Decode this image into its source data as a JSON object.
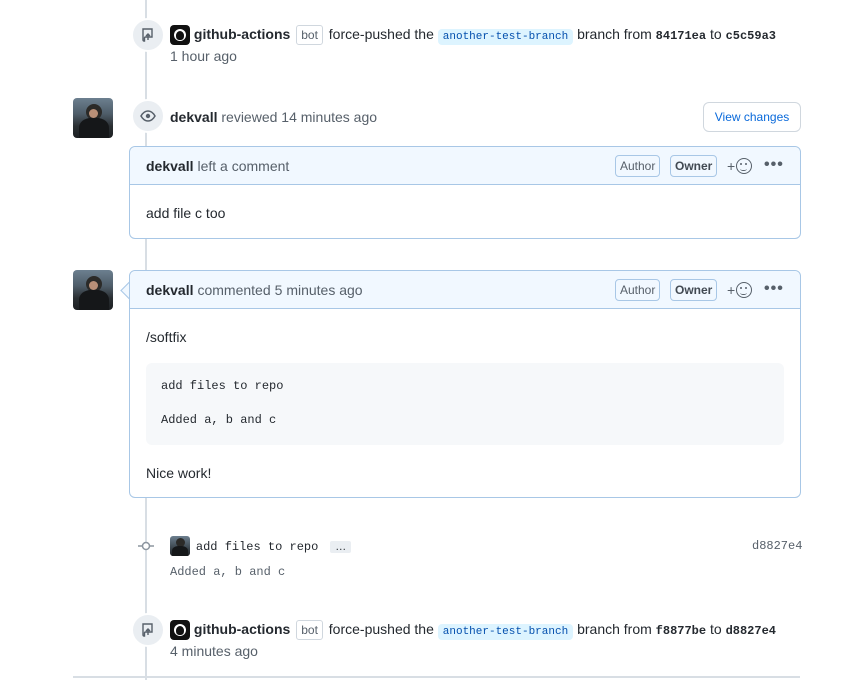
{
  "event1": {
    "actor": "github-actions",
    "bot_label": "bot",
    "action": "force-pushed the",
    "branch": "another-test-branch",
    "branch_word": "branch from",
    "from_sha": "84171ea",
    "to_word": "to",
    "to_sha": "c5c59a3",
    "time": "1 hour ago"
  },
  "review": {
    "actor": "dekvall",
    "action": "reviewed",
    "time": "14 minutes ago",
    "view_changes_label": "View changes",
    "comment": {
      "author": "dekvall",
      "action": "left a comment",
      "author_label": "Author",
      "owner_label": "Owner",
      "body": "add file c too"
    }
  },
  "comment2": {
    "author": "dekvall",
    "action": "commented",
    "time": "5 minutes ago",
    "author_label": "Author",
    "owner_label": "Owner",
    "body_line1": "/softfix",
    "code_line1": "add files to repo",
    "code_line2": "Added a, b and c",
    "body_line2": "Nice work!"
  },
  "commit": {
    "message": "add files to repo",
    "ellipsis": "…",
    "sha": "d8827e4",
    "description": "Added a, b and c"
  },
  "event2": {
    "actor": "github-actions",
    "bot_label": "bot",
    "action": "force-pushed the",
    "branch": "another-test-branch",
    "branch_word": "branch from",
    "from_sha": "f8877be",
    "to_word": "to",
    "to_sha": "d8827e4",
    "time": "4 minutes ago"
  },
  "icons": [
    "repo-push-icon",
    "eye-icon",
    "github-logo-icon",
    "smiley-icon",
    "kebab-icon",
    "git-commit-icon"
  ],
  "colors": {
    "link": "#0969da",
    "comment_border": "#a8c7e6",
    "comment_header_bg": "#f1f8ff",
    "branch_bg": "#ddf4ff"
  }
}
